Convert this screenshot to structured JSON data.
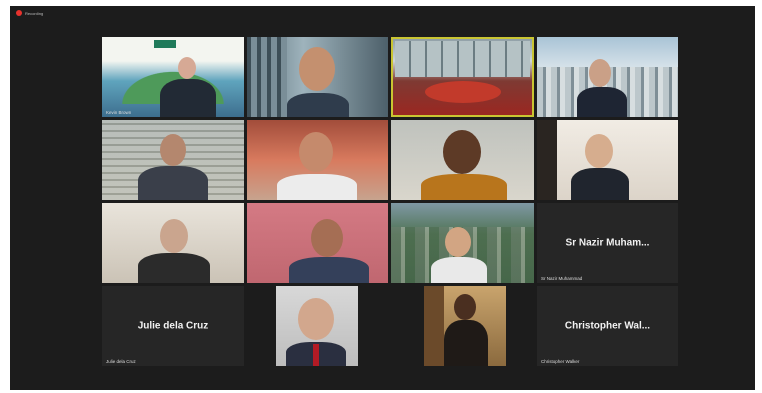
{
  "recording": {
    "label": "Recording"
  },
  "colors": {
    "background": "#1c1c1c",
    "tile": "#262626",
    "active_speaker_border": "#c9c532",
    "recording_dot": "#e8322d"
  },
  "tiles": [
    {
      "row": 1,
      "name_label": "Kevin Brown",
      "big_name": ""
    },
    {
      "row": 1,
      "name_label": "",
      "big_name": ""
    },
    {
      "row": 1,
      "name_label": "",
      "big_name": "",
      "active": true
    },
    {
      "row": 1,
      "name_label": "",
      "big_name": ""
    },
    {
      "row": 2,
      "name_label": "",
      "big_name": ""
    },
    {
      "row": 2,
      "name_label": "",
      "big_name": ""
    },
    {
      "row": 2,
      "name_label": "",
      "big_name": ""
    },
    {
      "row": 2,
      "name_label": "",
      "big_name": ""
    },
    {
      "row": 3,
      "name_label": "",
      "big_name": ""
    },
    {
      "row": 3,
      "name_label": "",
      "big_name": ""
    },
    {
      "row": 3,
      "name_label": "",
      "big_name": ""
    },
    {
      "row": 3,
      "name_label": "Sr Nazir Muhammad",
      "big_name": "Sr Nazir Muham..."
    },
    {
      "row": 4,
      "name_label": "Julie dela Cruz",
      "big_name": "Julie dela Cruz"
    },
    {
      "row": 4,
      "name_label": "",
      "big_name": ""
    },
    {
      "row": 4,
      "name_label": "",
      "big_name": ""
    },
    {
      "row": 4,
      "name_label": "Christopher Walker",
      "big_name": "Christopher Wal..."
    }
  ]
}
